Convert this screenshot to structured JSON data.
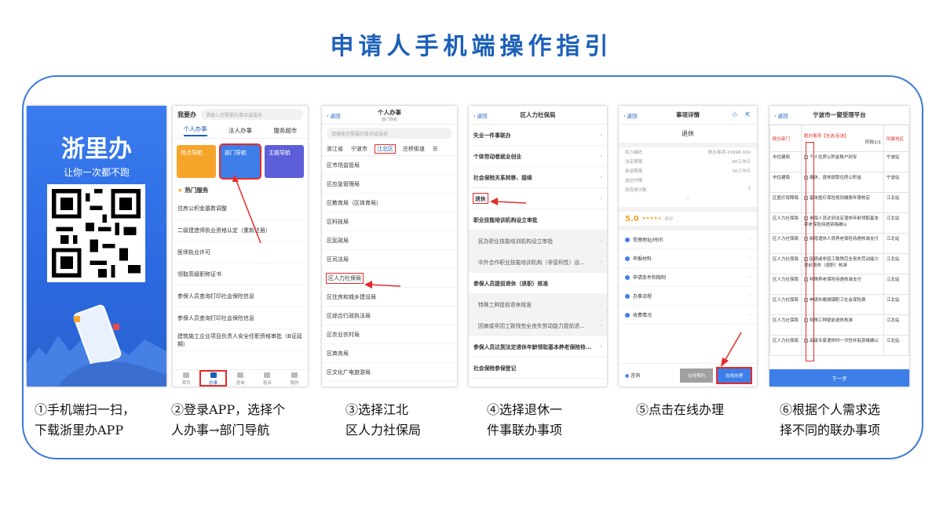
{
  "page_title": "申请人手机端操作指引",
  "steps": [
    {
      "caption_1": "①手机端扫一扫，",
      "caption_2": "下载浙里办APP"
    },
    {
      "caption_1": "②登录APP，选择个",
      "caption_2": "人办事→部门导航"
    },
    {
      "caption_1": "③选择江北",
      "caption_2": "区人力社保局"
    },
    {
      "caption_1": "④选择退休一",
      "caption_2": "件事联办事项"
    },
    {
      "caption_1": "⑤点击在线办理",
      "caption_2": ""
    },
    {
      "caption_1": "⑥根据个人需求选",
      "caption_2": "择不同的联办事项"
    }
  ],
  "screen1": {
    "brand": "浙里办",
    "slogan": "让你一次都不跑"
  },
  "screen2": {
    "header": "我要办",
    "search_placeholder": "请输入您需要的事项或服务",
    "tabs": [
      "个人办事",
      "法人办事",
      "服务超市"
    ],
    "nav_buttons": [
      "热点导航",
      "部门导航",
      "主题导航"
    ],
    "hot_title": "热门服务",
    "services": [
      "住房公积金基数调整",
      "二级建造师执业资格认定（重新注册）",
      "医师执业许可",
      "领取高级职称证书",
      "参保人员查询打印社会保险信息",
      "参保人员查询打印社会保险信息",
      "建筑施工企业项目负责人安全任职资格审批（B证延期）"
    ],
    "tabbar": [
      "首页",
      "办事",
      "咨询",
      "投诉",
      "我的"
    ]
  },
  "screen3": {
    "back": "返回",
    "title": "个人办事",
    "subtitle": "部门导航",
    "search_placeholder": "请搜索您需要的事项或服务",
    "regions": [
      "浙江省",
      "宁波市",
      "江北区",
      "庄桥街道"
    ],
    "departments": [
      "区市场监管局",
      "区应急管理局",
      "区教育局（区体育局）",
      "区科技局",
      "区民政局",
      "区司法局",
      "区人力社保局",
      "区住房和城乡建设局",
      "区综合行政执法局",
      "区农业农村局",
      "区商务局",
      "区文化广电旅游局"
    ]
  },
  "screen4": {
    "back": "返回",
    "title": "区人力社保局",
    "items": [
      {
        "label": "失业一件事联办",
        "kind": "group",
        "chev": true
      },
      {
        "label": "个体劳动者就业创业",
        "kind": "group",
        "chev": true
      },
      {
        "label": "社会保险关系转移、接续",
        "kind": "group",
        "chev": true
      },
      {
        "label": "退休",
        "kind": "group",
        "chev": true
      },
      {
        "label": "职业技能培训机构设立审批",
        "kind": "group",
        "chev": false
      },
      {
        "label": "民办职业技能培训机构设立审批",
        "kind": "sub",
        "chev": true
      },
      {
        "label": "中外合作职业技能培训机构（非营利性）设...",
        "kind": "sub",
        "chev": true
      },
      {
        "label": "参保人员提前退休（退职）核准",
        "kind": "group",
        "chev": false
      },
      {
        "label": "特殊工种提前退休核准",
        "kind": "sub",
        "chev": true
      },
      {
        "label": "因病或非因工致残完全丧失劳动能力提前退...",
        "kind": "sub",
        "chev": true
      },
      {
        "label": "参保人员达到法定退休年龄领取基本养老保险待...",
        "kind": "group",
        "chev": true
      },
      {
        "label": "社会保险参保登记",
        "kind": "group",
        "chev": false
      }
    ]
  },
  "screen5": {
    "back": "返回",
    "title": "事项详情",
    "item_name": "退休",
    "fields": [
      {
        "k": "权力编码",
        "v": "联办事项-19998-000"
      },
      {
        "k": "法定期限",
        "v": "80工作日"
      },
      {
        "k": "承诺期限",
        "v": "30工作日"
      },
      {
        "k": "送达时限",
        "v": ""
      },
      {
        "k": "到现场次数",
        "v": "1"
      }
    ],
    "score": "5.0",
    "stars": "★★★★★",
    "score_label": "评分",
    "menu": [
      "受理地址/时间",
      "申报材料",
      "申请条件和限制",
      "办事流程",
      "收费情况"
    ],
    "consult": "咨询",
    "btn_gray": "在线预约",
    "btn_blue": "在线办理"
  },
  "screen6": {
    "back": "返回",
    "title": "宁波市一窗受理平台",
    "col_dept": "联办部门",
    "col_item": "联办事项【全选/反选】",
    "col_region": "所属地区",
    "stage": "阶段1/1",
    "rows": [
      {
        "dept": "市住建局",
        "item": "个人住房公积金账户封存",
        "region": "宁波站"
      },
      {
        "dept": "市住建局",
        "item": "离休、退休提取住房公积金",
        "region": "宁波站"
      },
      {
        "dept": "区医疗保障局",
        "item": "基本医疗保险视同缴费年限核定",
        "region": "江北站"
      },
      {
        "dept": "区人力社保局",
        "item": "参保人员达到法定退休年龄领取基本养老保险待遇资格确认",
        "region": "江北站"
      },
      {
        "dept": "区人力社保局",
        "item": "新增退休人员养老保险待遇核准支付",
        "region": "江北站"
      },
      {
        "dept": "区人力社保局",
        "item": "因病或非因工致残完全丧失劳动能力提前退休（退职）核准",
        "region": "江北站"
      },
      {
        "dept": "区人力社保局",
        "item": "特殊养老保险待遇核准支付",
        "region": "江北站"
      },
      {
        "dept": "区人力社保局",
        "item": "申请补缴城镇职工社会保险费",
        "region": "江北站"
      },
      {
        "dept": "区人力社保局",
        "item": "特殊工种提前退休核准",
        "region": "江北站"
      },
      {
        "dept": "区人力社保局",
        "item": "高级专家退休时一次性补贴资格确认",
        "region": "江北站"
      }
    ],
    "next": "下一步"
  },
  "colors": {
    "title": "#1b5fb8",
    "frame": "#3c78d8",
    "highlight": "#e52b2b",
    "accent": "#3d7ee8"
  }
}
